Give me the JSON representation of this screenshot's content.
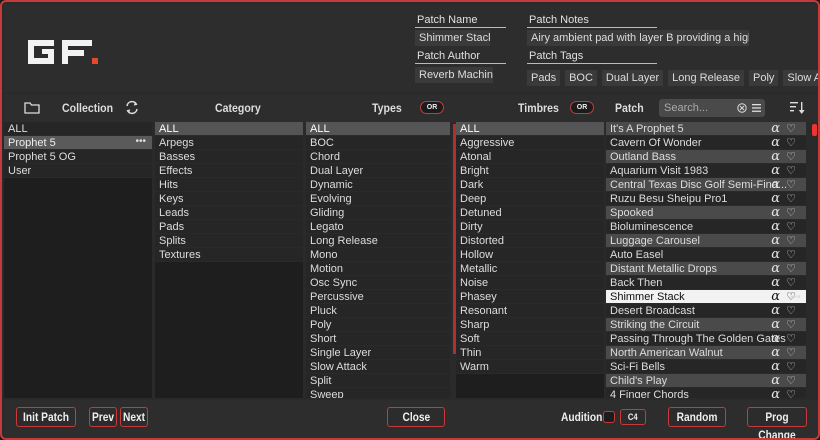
{
  "header": {
    "patch_name_label": "Patch Name",
    "patch_name": "Shimmer Stack",
    "patch_author_label": "Patch Author",
    "patch_author": "Reverb Machine",
    "patch_notes_label": "Patch Notes",
    "patch_notes": "Airy ambient pad with layer B providing a higher ...",
    "patch_tags_label": "Patch Tags",
    "patch_tags": [
      "Pads",
      "BOC",
      "Dual Layer",
      "Long Release",
      "Poly",
      "Slow Attack"
    ]
  },
  "toolbar": {
    "collection": "Collection",
    "category": "Category",
    "types": "Types",
    "types_mode": "OR",
    "timbres": "Timbres",
    "timbres_mode": "OR",
    "patch": "Patch",
    "search_placeholder": "Search..."
  },
  "collections": [
    "ALL",
    "Prophet 5",
    "Prophet 5 OG",
    "User"
  ],
  "categories": [
    "ALL",
    "Arpegs",
    "Basses",
    "Effects",
    "Hits",
    "Keys",
    "Leads",
    "Pads",
    "Splits",
    "Textures"
  ],
  "types": [
    "ALL",
    "BOC",
    "Chord",
    "Dual Layer",
    "Dynamic",
    "Evolving",
    "Gliding",
    "Legato",
    "Long Release",
    "Mono",
    "Motion",
    "Osc Sync",
    "Percussive",
    "Pluck",
    "Poly",
    "Short",
    "Single Layer",
    "Slow Attack",
    "Split",
    "Sweep"
  ],
  "timbres": [
    "ALL",
    "Aggressive",
    "Atonal",
    "Bright",
    "Dark",
    "Deep",
    "Detuned",
    "Dirty",
    "Distorted",
    "Hollow",
    "Metallic",
    "Noise",
    "Phasey",
    "Resonant",
    "Sharp",
    "Soft",
    "Thin",
    "Warm"
  ],
  "patches": [
    "It's A Prophet 5",
    "Cavern Of Wonder",
    "Outland Bass",
    "Aquarium Visit 1983",
    "Central Texas Disc Golf Semi-Fina...",
    "Ruzu Besu Sheipu Pro1",
    "Spooked",
    "Bioluminescence",
    "Luggage Carousel",
    "Auto Easel",
    "Distant Metallic Drops",
    "Back Then",
    "Shimmer Stack",
    "Desert Broadcast",
    "Striking the Circuit",
    "Passing Through The Golden Gates",
    "North American Walnut",
    "Sci-Fi Bells",
    "Child's Play",
    "4 Finger Chords"
  ],
  "footer": {
    "init_patch": "Init Patch",
    "prev": "Prev",
    "next": "Next",
    "close": "Close",
    "audition": "Audition",
    "audition_note": "C4",
    "random": "Random",
    "prog_change": "Prog Change"
  },
  "icons": {
    "alpha": "α",
    "heart": "♡",
    "more": "•••"
  },
  "colors": {
    "accent": "#c63a3a"
  }
}
